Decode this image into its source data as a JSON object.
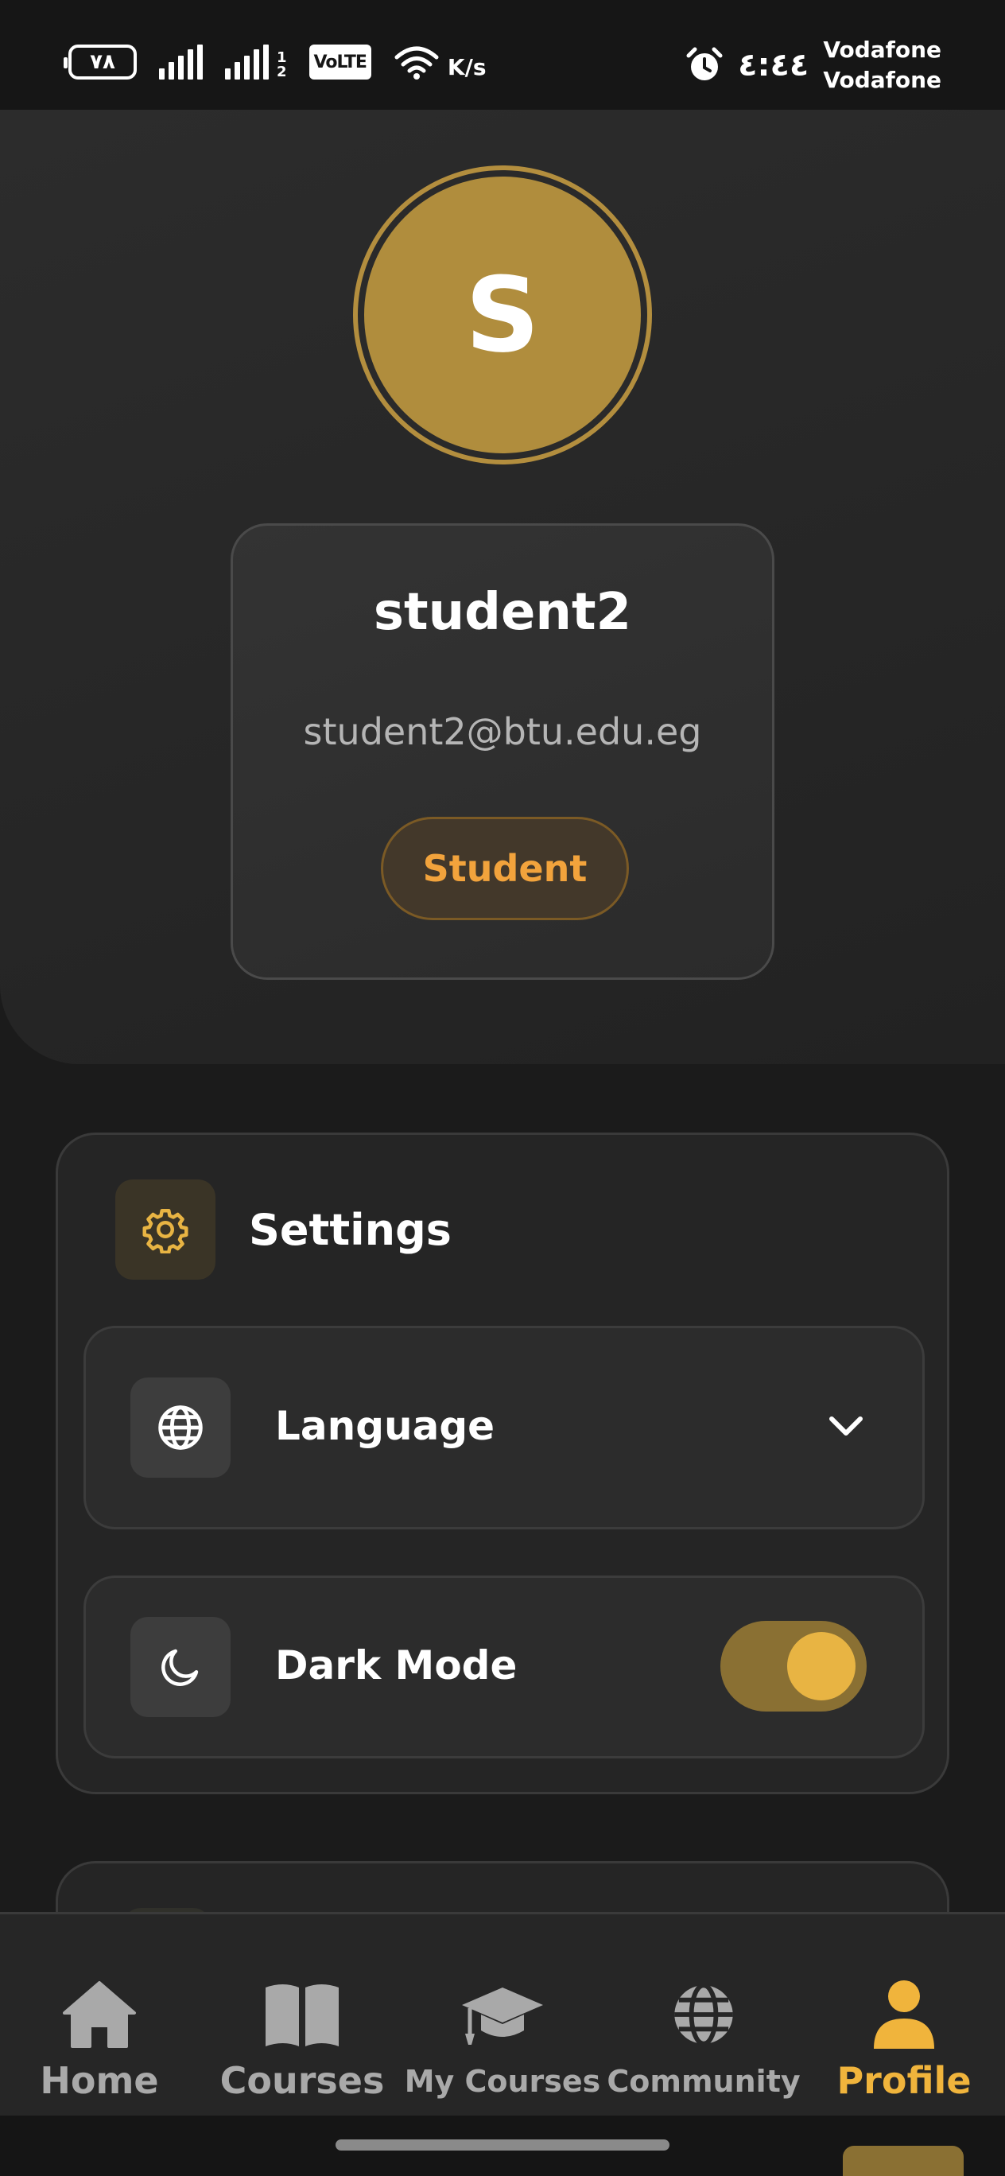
{
  "status_bar": {
    "battery": "٧٨",
    "sim_index_top": "1",
    "sim_index_bottom": "2",
    "volte": "VoLTE",
    "speed": "K/s",
    "time": "٤:٤٤",
    "carrier1": "Vodafone",
    "carrier2": "Vodafone"
  },
  "profile": {
    "avatar_initial": "S",
    "name": "student2",
    "email": "student2@btu.edu.eg",
    "role": "Student"
  },
  "settings": {
    "title": "Settings",
    "language_label": "Language",
    "dark_mode_label": "Dark Mode",
    "dark_mode_on": true
  },
  "nav": {
    "home": "Home",
    "courses": "Courses",
    "my_courses": "My Courses",
    "community": "Community",
    "profile": "Profile",
    "active": "profile"
  },
  "colors": {
    "accent": "#f0b43c",
    "avatar": "#b08d3d",
    "background": "#1b1b1b"
  }
}
